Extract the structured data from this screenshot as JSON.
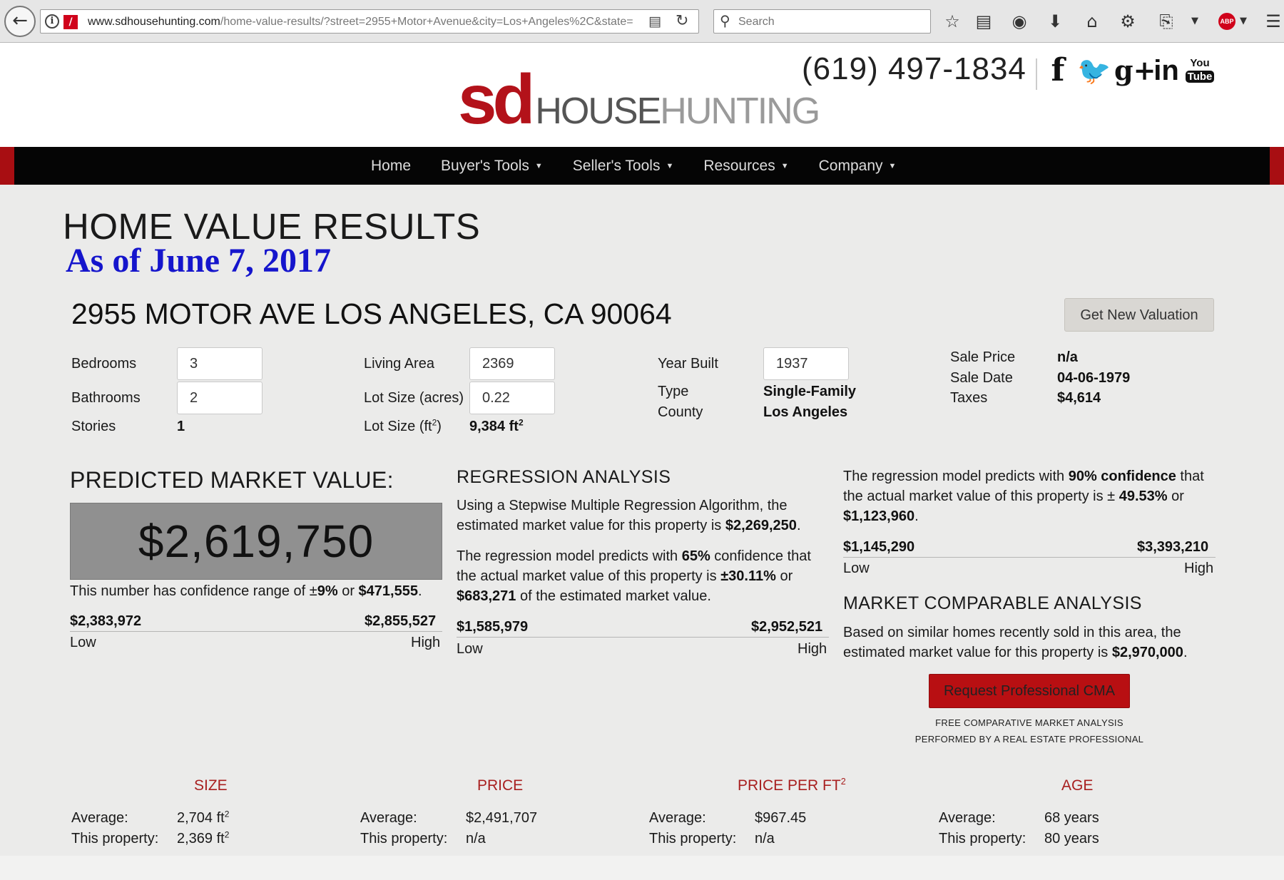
{
  "browser": {
    "url_domain": "www.sdhousehunting.com",
    "url_path": "/home-value-results/?street=2955+Motor+Avenue&city=Los+Angeles%2C&state=",
    "search_placeholder": "Search",
    "abp_label": "ABP"
  },
  "site": {
    "logo_sd": "sd",
    "logo_house": "HOUSE",
    "logo_hunting": "HUNTING",
    "phone": "(619) 497-1834",
    "social": {
      "facebook": "f",
      "googleplus": "g+",
      "linkedin": "in",
      "youtube_you": "You",
      "youtube_tube": "Tube"
    }
  },
  "nav": {
    "items": [
      "Home",
      "Buyer's Tools",
      "Seller's Tools",
      "Resources",
      "Company"
    ]
  },
  "page": {
    "title": "HOME VALUE RESULTS",
    "as_of": "As of June 7, 2017",
    "address": "2955 MOTOR AVE LOS ANGELES, CA 90064",
    "new_valuation_label": "Get New Valuation"
  },
  "property": {
    "bedrooms_label": "Bedrooms",
    "bedrooms": "3",
    "bathrooms_label": "Bathrooms",
    "bathrooms": "2",
    "stories_label": "Stories",
    "stories": "1",
    "living_area_label": "Living Area",
    "living_area": "2369",
    "lot_acres_label": "Lot Size (acres)",
    "lot_acres": "0.22",
    "lot_ft_label": "Lot Size (ft",
    "lot_ft_label_end": ")",
    "lot_ft": "9,384 ft",
    "year_built_label": "Year Built",
    "year_built": "1937",
    "type_label": "Type",
    "type": "Single-Family",
    "county_label": "County",
    "county": "Los Angeles",
    "sale_price_label": "Sale Price",
    "sale_price": "n/a",
    "sale_date_label": "Sale Date",
    "sale_date": "04-06-1979",
    "taxes_label": "Taxes",
    "taxes": "$4,614"
  },
  "predicted": {
    "title": "PREDICTED MARKET VALUE:",
    "value": "$2,619,750",
    "conf_prefix": "This number has confidence range of ±",
    "conf_pct": "9%",
    "conf_mid": " or ",
    "conf_amount": "$471,555",
    "conf_suffix": ".",
    "low": "$2,383,972",
    "high": "$2,855,527",
    "low_label": "Low",
    "high_label": "High"
  },
  "regression": {
    "title": "REGRESSION ANALYSIS",
    "p1_prefix": "Using a Stepwise Multiple Regression Algorithm, the estimated market value for this property is ",
    "p1_value": "$2,269,250",
    "p1_suffix": ".",
    "p2_a": "The regression model predicts with ",
    "p2_conf": "65%",
    "p2_b": " confidence that the actual market value of this property is ",
    "p2_pct": "±30.11%",
    "p2_c": " or ",
    "p2_amount": "$683,271",
    "p2_d": " of the estimated market value.",
    "low": "$1,585,979",
    "high": "$2,952,521",
    "low_label": "Low",
    "high_label": "High"
  },
  "confidence90": {
    "p_a": "The regression model predicts with ",
    "p_conf": "90% confidence",
    "p_b": " that the actual market value of this property is ± ",
    "p_pct": "49.53%",
    "p_c": " or ",
    "p_amount": "$1,123,960",
    "p_d": ".",
    "low": "$1,145,290",
    "high": "$3,393,210",
    "low_label": "Low",
    "high_label": "High"
  },
  "comparable": {
    "title": "MARKET COMPARABLE ANALYSIS",
    "p_prefix": "Based on similar homes recently sold in this area, the estimated market value for this property is ",
    "p_value": "$2,970,000",
    "p_suffix": ".",
    "cma_button": "Request Professional CMA",
    "note_line1": "FREE COMPARATIVE MARKET ANALYSIS",
    "note_line2": "PERFORMED BY A REAL ESTATE PROFESSIONAL"
  },
  "stats": {
    "avg_label": "Average:",
    "this_label": "This property:",
    "size": {
      "head": "SIZE",
      "avg": "2,704 ft",
      "this": "2,369 ft"
    },
    "price": {
      "head": "PRICE",
      "avg": "$2,491,707",
      "this": "n/a"
    },
    "ppf": {
      "head": "PRICE PER FT",
      "avg": "$967.45",
      "this": "n/a"
    },
    "age": {
      "head": "AGE",
      "avg": "68 years",
      "this": "80 years"
    }
  },
  "colors": {
    "brand_red": "#b3121a",
    "date_blue": "#1515cc",
    "nav_bg": "#050505"
  }
}
